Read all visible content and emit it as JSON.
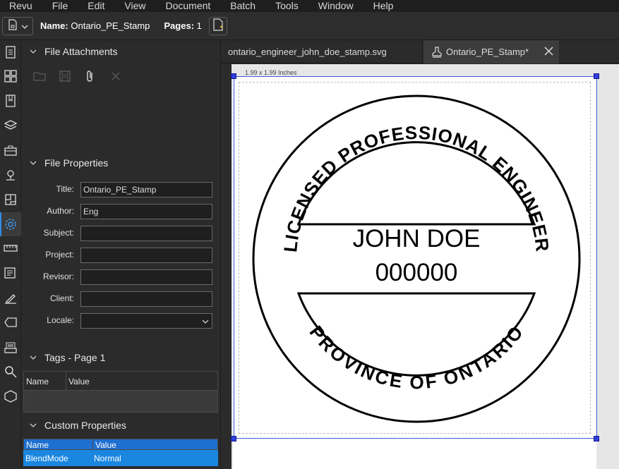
{
  "menu": [
    "Revu",
    "File",
    "Edit",
    "View",
    "Document",
    "Batch",
    "Tools",
    "Window",
    "Help"
  ],
  "toolbar": {
    "name_label": "Name:",
    "name_value": "Ontario_PE_Stamp",
    "pages_label": "Pages:",
    "pages_value": "1"
  },
  "sidebar_icons": [
    "thumbnails-icon",
    "grid-icon",
    "bookmarks-icon",
    "layers-icon",
    "toolbox-icon",
    "places-icon",
    "spaces-icon",
    "properties-icon",
    "measure-icon",
    "markups-list-icon",
    "signatures-icon",
    "tags-icon",
    "studio-icon",
    "search-icon",
    "3d-icon"
  ],
  "panel": {
    "attachments_title": "File Attachments",
    "file_properties_title": "File Properties",
    "fields": [
      {
        "label": "Title:",
        "value": "Ontario_PE_Stamp"
      },
      {
        "label": "Author:",
        "value": "Eng"
      },
      {
        "label": "Subject:",
        "value": ""
      },
      {
        "label": "Project:",
        "value": ""
      },
      {
        "label": "Revisor:",
        "value": ""
      },
      {
        "label": "Client:",
        "value": ""
      }
    ],
    "locale_label": "Locale:",
    "locale_value": "",
    "tags_title": "Tags - Page 1",
    "tags_columns": [
      "Name",
      "Value"
    ],
    "custom_title": "Custom Properties",
    "custom_columns": [
      "Name",
      "Value"
    ],
    "custom_rows": [
      {
        "name": "BlendMode",
        "value": "Normal"
      }
    ]
  },
  "tabs": [
    {
      "label": "ontario_engineer_john_doe_stamp.svg"
    },
    {
      "label": "Ontario_PE_Stamp*"
    }
  ],
  "canvas": {
    "size_label": "1.99 x 1.99 Inches",
    "stamp": {
      "top_arc": "LICENSED PROFESSIONAL ENGINEER",
      "bottom_arc": "PROVINCE OF ONTARIO",
      "name": "JOHN DOE",
      "number": "000000"
    }
  },
  "colors": {
    "accent": "#2f8de4",
    "selection": "#1a86e0",
    "handle": "#2e3fe0"
  }
}
